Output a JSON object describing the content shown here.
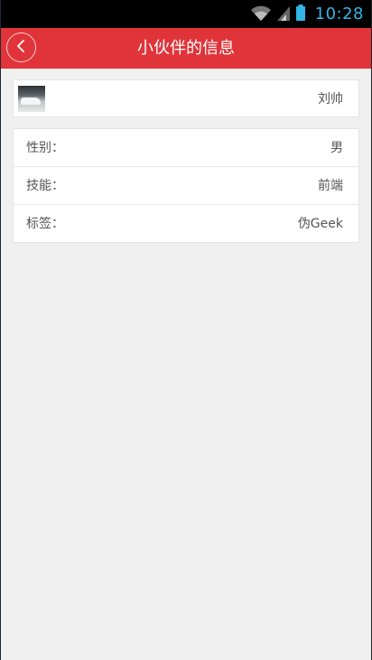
{
  "status_bar": {
    "time": "10:28",
    "icons": [
      "wifi-icon",
      "signal-icon",
      "battery-icon"
    ]
  },
  "header": {
    "title": "小伙伴的信息",
    "back_icon": "chevron-left-icon",
    "color": "#e0343a"
  },
  "profile": {
    "name": "刘帅",
    "avatar": "avatar-photo"
  },
  "details": [
    {
      "label": "性别：",
      "value": "男"
    },
    {
      "label": "技能：",
      "value": "前端"
    },
    {
      "label": "标签：",
      "value": "伪Geek"
    }
  ]
}
